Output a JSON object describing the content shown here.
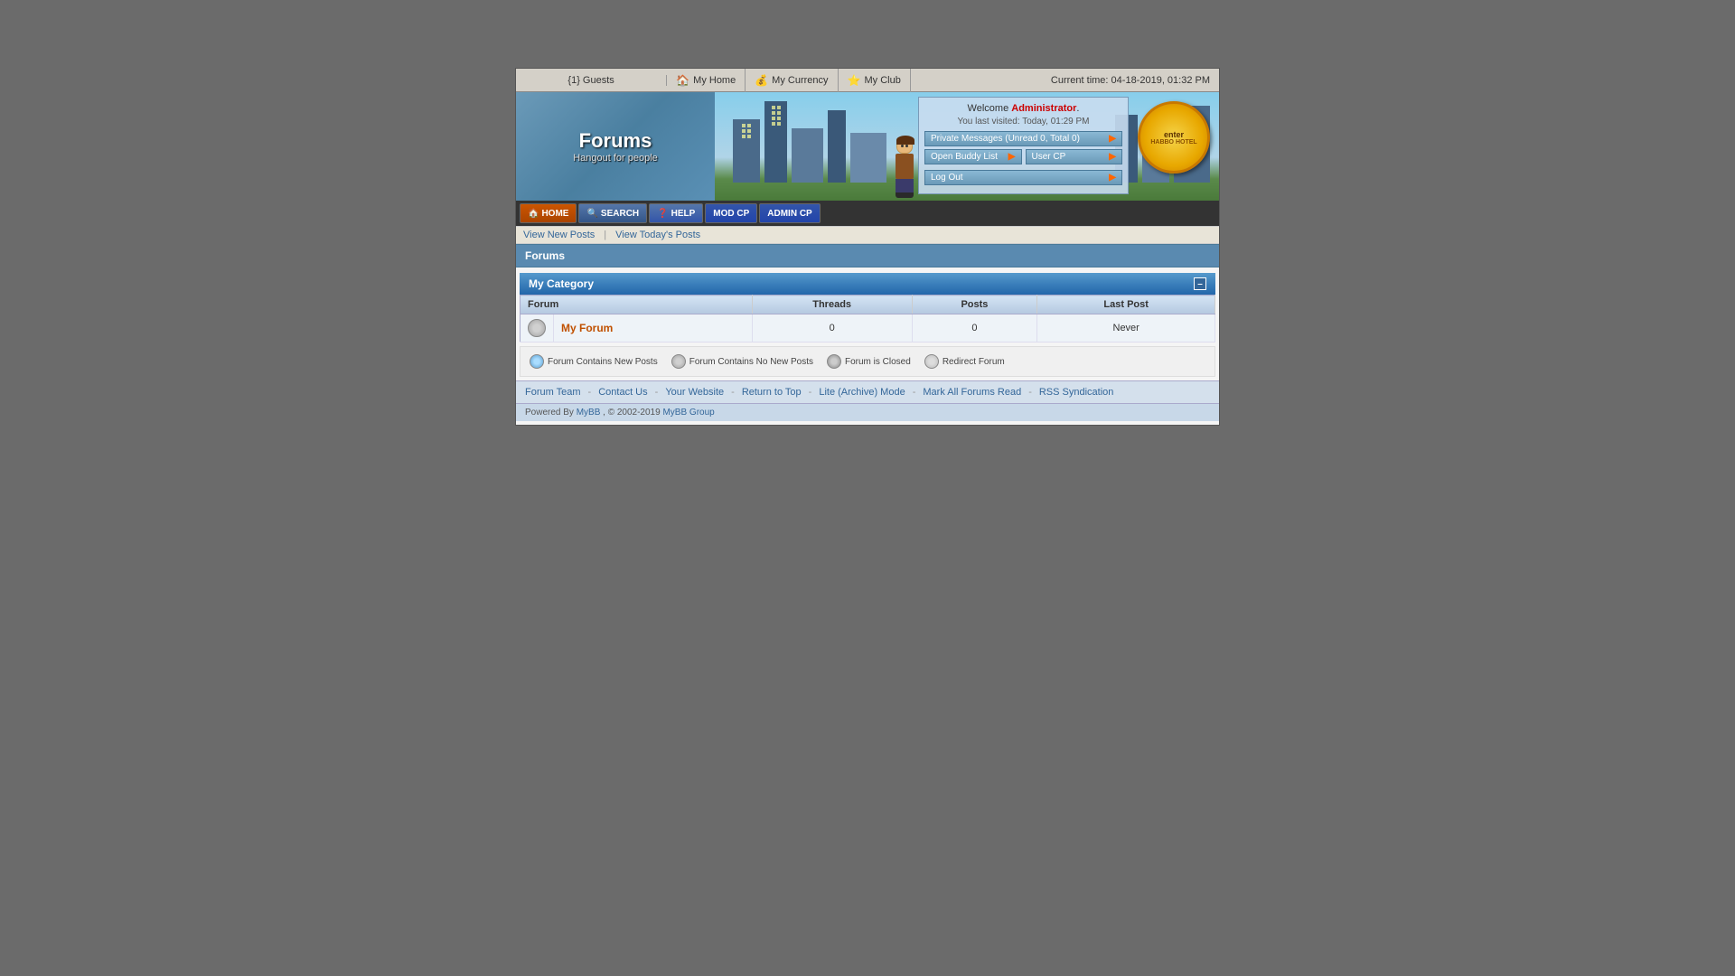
{
  "topbar": {
    "guests_label": "{1} Guests",
    "nav_items": [
      {
        "label": "My Home",
        "icon": "home-icon"
      },
      {
        "label": "My Currency",
        "icon": "currency-icon"
      },
      {
        "label": "My Club",
        "icon": "club-icon"
      }
    ],
    "time_label": "Current time:",
    "time_value": "04-18-2019, 01:32 PM"
  },
  "header": {
    "logo_title": "Forums",
    "logo_subtitle": "Hangout for people",
    "habbo_badge_line1": "enter",
    "habbo_badge_line2": "HABBO HOTEL"
  },
  "welcome": {
    "text": "Welcome",
    "username": "Administrator",
    "last_visited": "You last visited: Today, 01:29 PM",
    "pm_btn": "Private Messages (Unread 0, Total 0)",
    "buddy_btn": "Open Buddy List",
    "usercp_btn": "User CP",
    "logout_btn": "Log Out"
  },
  "navbar": {
    "home": "HOME",
    "search": "SEARCH",
    "help": "HELP",
    "modcp": "MOD CP",
    "admincp": "ADMIN CP"
  },
  "quick_links": {
    "new_posts": "View New Posts",
    "todays_posts": "View Today's Posts"
  },
  "forums_title": "Forums",
  "category": {
    "name": "My Category"
  },
  "table": {
    "col_forum": "Forum",
    "col_threads": "Threads",
    "col_posts": "Posts",
    "col_last_post": "Last Post",
    "rows": [
      {
        "name": "My Forum",
        "threads": "0",
        "posts": "0",
        "last_post": "Never"
      }
    ]
  },
  "legend": {
    "items": [
      {
        "icon": "new",
        "label": "Forum Contains New Posts"
      },
      {
        "icon": "nonew",
        "label": "Forum Contains No New Posts"
      },
      {
        "icon": "closed",
        "label": "Forum is Closed"
      },
      {
        "icon": "redirect",
        "label": "Redirect Forum"
      }
    ]
  },
  "footer": {
    "links": [
      {
        "label": "Forum Team"
      },
      {
        "label": "Contact Us"
      },
      {
        "label": "Your Website"
      },
      {
        "label": "Return to Top"
      },
      {
        "label": "Lite (Archive) Mode"
      },
      {
        "label": "Mark All Forums Read"
      },
      {
        "label": "RSS Syndication"
      }
    ]
  },
  "powered_by": {
    "text": "Powered By",
    "mybb_label": "MyBB",
    "copyright": ", © 2002-2019",
    "group_label": "MyBB Group"
  }
}
